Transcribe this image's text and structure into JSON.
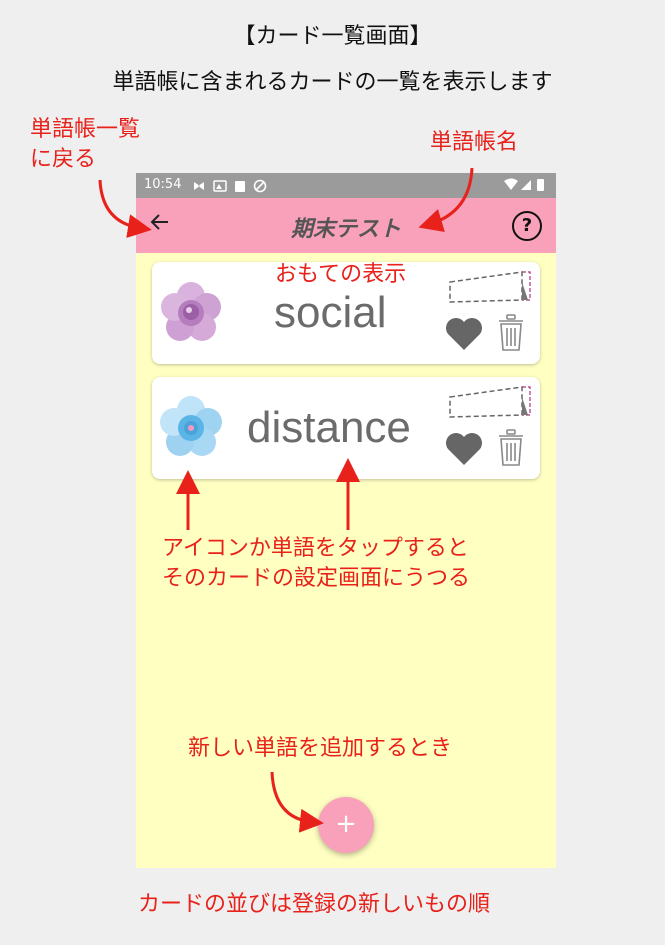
{
  "header": {
    "title": "【カード一覧画面】",
    "subtitle": "単語帳に含まれるカードの一覧を表示します"
  },
  "annotations": {
    "back_line1": "単語帳一覧",
    "back_line2": "に戻る",
    "deck_name": "単語帳名",
    "front_display": "おもての表示",
    "tap_line1": "アイコンか単語をタップすると",
    "tap_line2": "そのカードの設定画面にうつる",
    "add_word": "新しい単語を追加するとき",
    "order_note": "カードの並びは登録の新しいもの順"
  },
  "status_bar": {
    "time": "10:54"
  },
  "app_bar": {
    "title": "期末テスト",
    "back_icon": "arrow-left-icon",
    "help_icon": "question-circle-icon"
  },
  "cards": [
    {
      "word": "social",
      "icon": "purple-rose-icon"
    },
    {
      "word": "distance",
      "icon": "blue-flower-icon"
    }
  ],
  "fab": {
    "label": "+"
  },
  "colors": {
    "appbar": "#f9a1ba",
    "background": "#ffffc2",
    "annotation": "#e8211b"
  }
}
